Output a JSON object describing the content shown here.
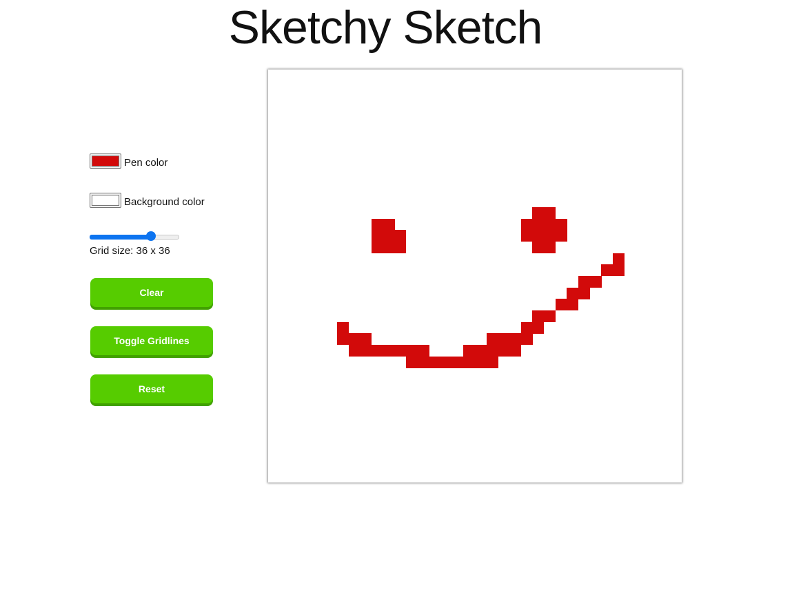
{
  "title": "Sketchy Sketch",
  "controls": {
    "pen_color_label": "Pen color",
    "pen_color": "#d20a0a",
    "background_color_label": "Background color",
    "background_color": "#ffffff",
    "slider": {
      "min": 1,
      "max": 50,
      "value": 36
    },
    "grid_size_text": "Grid size: 36 x 36",
    "clear_label": "Clear",
    "toggle_gridlines_label": "Toggle Gridlines",
    "reset_label": "Reset"
  },
  "canvas": {
    "grid_size": 36,
    "accent_button": "#56cc00",
    "slider_color": "#0d74f0",
    "filled_cells": [
      [
        9,
        13
      ],
      [
        10,
        13
      ],
      [
        9,
        14
      ],
      [
        10,
        14
      ],
      [
        11,
        14
      ],
      [
        9,
        15
      ],
      [
        10,
        15
      ],
      [
        11,
        15
      ],
      [
        23,
        12
      ],
      [
        24,
        12
      ],
      [
        22,
        13
      ],
      [
        23,
        13
      ],
      [
        24,
        13
      ],
      [
        25,
        13
      ],
      [
        22,
        14
      ],
      [
        23,
        14
      ],
      [
        24,
        14
      ],
      [
        25,
        14
      ],
      [
        23,
        15
      ],
      [
        24,
        15
      ],
      [
        30,
        16
      ],
      [
        29,
        17
      ],
      [
        30,
        17
      ],
      [
        27,
        18
      ],
      [
        28,
        18
      ],
      [
        26,
        19
      ],
      [
        27,
        19
      ],
      [
        25,
        20
      ],
      [
        26,
        20
      ],
      [
        23,
        21
      ],
      [
        24,
        21
      ],
      [
        22,
        22
      ],
      [
        23,
        22
      ],
      [
        6,
        22
      ],
      [
        6,
        23
      ],
      [
        7,
        23
      ],
      [
        8,
        23
      ],
      [
        19,
        23
      ],
      [
        20,
        23
      ],
      [
        21,
        23
      ],
      [
        22,
        23
      ],
      [
        7,
        24
      ],
      [
        8,
        24
      ],
      [
        9,
        24
      ],
      [
        10,
        24
      ],
      [
        11,
        24
      ],
      [
        12,
        24
      ],
      [
        13,
        24
      ],
      [
        17,
        24
      ],
      [
        18,
        24
      ],
      [
        19,
        24
      ],
      [
        20,
        24
      ],
      [
        21,
        24
      ],
      [
        12,
        25
      ],
      [
        13,
        25
      ],
      [
        14,
        25
      ],
      [
        15,
        25
      ],
      [
        16,
        25
      ],
      [
        17,
        25
      ],
      [
        18,
        25
      ],
      [
        19,
        25
      ]
    ]
  }
}
